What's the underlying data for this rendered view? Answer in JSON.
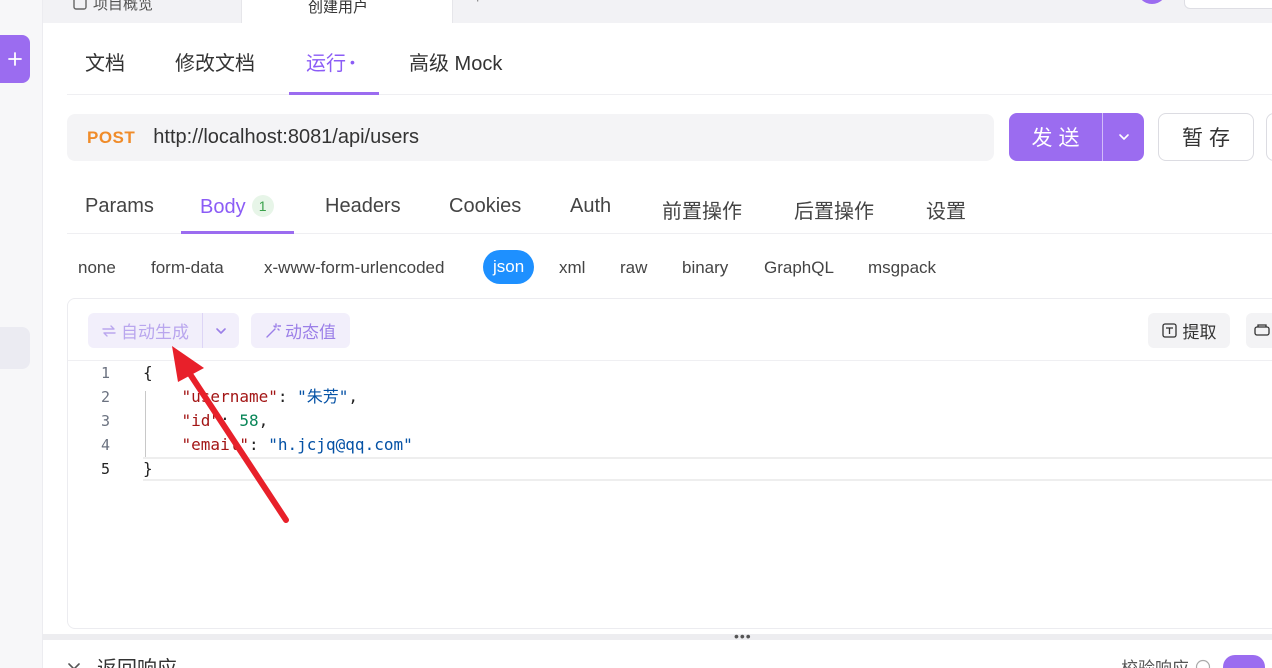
{
  "window_tabs": [
    {
      "label": "项目概览"
    },
    {
      "label": "创建用户"
    }
  ],
  "main_tabs": [
    {
      "label": "文档"
    },
    {
      "label": "修改文档"
    },
    {
      "label": "运行",
      "dot": "•"
    },
    {
      "label": "高级 Mock"
    }
  ],
  "request": {
    "method": "POST",
    "url": "http://localhost:8081/api/users",
    "send_label": "发送",
    "save_label": "暂存"
  },
  "request_tabs": [
    {
      "label": "Params"
    },
    {
      "label": "Body",
      "badge": "1"
    },
    {
      "label": "Headers"
    },
    {
      "label": "Cookies"
    },
    {
      "label": "Auth"
    },
    {
      "label": "前置操作"
    },
    {
      "label": "后置操作"
    },
    {
      "label": "设置"
    }
  ],
  "body_types": [
    "none",
    "form-data",
    "x-www-form-urlencoded",
    "json",
    "xml",
    "raw",
    "binary",
    "GraphQL",
    "msgpack"
  ],
  "body_type_selected": "json",
  "editor_toolbar": {
    "auto_generate": "自动生成",
    "dynamic_value": "动态值",
    "extract": "提取"
  },
  "code_lines": [
    {
      "num": "1",
      "open": "{"
    },
    {
      "num": "2",
      "key": "\"username\"",
      "value": "\"朱芳\"",
      "value_type": "string",
      "trail": ","
    },
    {
      "num": "3",
      "key": "\"id\"",
      "value": "58",
      "value_type": "number",
      "trail": ","
    },
    {
      "num": "4",
      "key": "\"email\"",
      "value": "\"h.jcjq@qq.com\"",
      "value_type": "string",
      "trail": ""
    },
    {
      "num": "5",
      "open": "}"
    }
  ],
  "response": {
    "label": "返回响应",
    "validate_label": "校验响应"
  },
  "colors": {
    "accent": "#9b6cf0",
    "method_post": "#f08c2a",
    "json_selected": "#1e90ff",
    "annotation_arrow": "#e8202a"
  }
}
